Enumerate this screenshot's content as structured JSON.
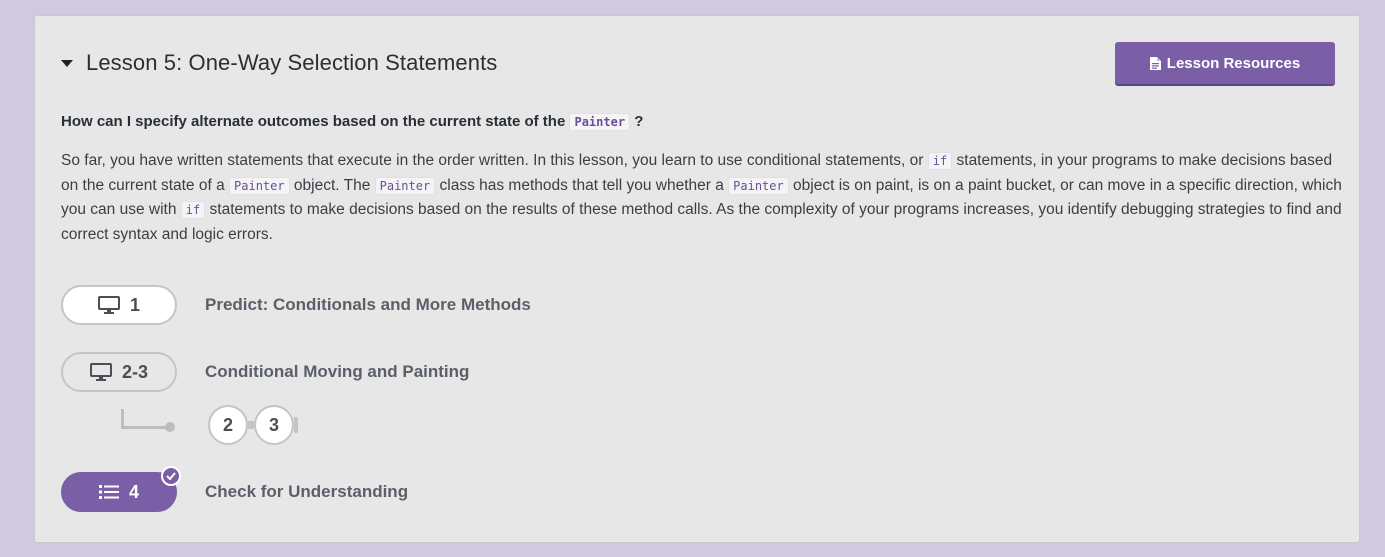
{
  "lesson": {
    "title": "Lesson 5: One-Way Selection Statements",
    "resources_label": "Lesson Resources",
    "question": {
      "before": "How can I specify alternate outcomes based on the current state of the ",
      "code": "Painter",
      "after": "?"
    },
    "description": {
      "p1": "So far, you have written statements that execute in the order written. In this lesson, you learn to use conditional statements, or ",
      "c1": "if",
      "p2": " statements, in your programs to make decisions based on the current state of a ",
      "c2": "Painter",
      "p3": " object. The ",
      "c3": "Painter",
      "p4": " class has methods that tell you whether a ",
      "c4": "Painter",
      "p5": " object is on paint, is on a paint bucket, or can move in a specific direction, which you can use with ",
      "c5": "if",
      "p6": " statements to make decisions based on the results of these method calls. As the complexity of your programs increases, you identify debugging strategies to find and correct syntax and logic errors."
    }
  },
  "levels": [
    {
      "number": "1",
      "name": "Predict: Conditionals and More Methods",
      "icon": "monitor-icon"
    },
    {
      "number": "2-3",
      "name": "Conditional Moving and Painting",
      "icon": "monitor-icon",
      "sublevels": [
        "2",
        "3"
      ]
    },
    {
      "number": "4",
      "name": "Check for Understanding",
      "icon": "list-icon",
      "completed": true
    }
  ],
  "colors": {
    "accent": "#7b5fa6",
    "page_bg": "#d0c9e0",
    "card_bg": "#e7e7e8"
  }
}
